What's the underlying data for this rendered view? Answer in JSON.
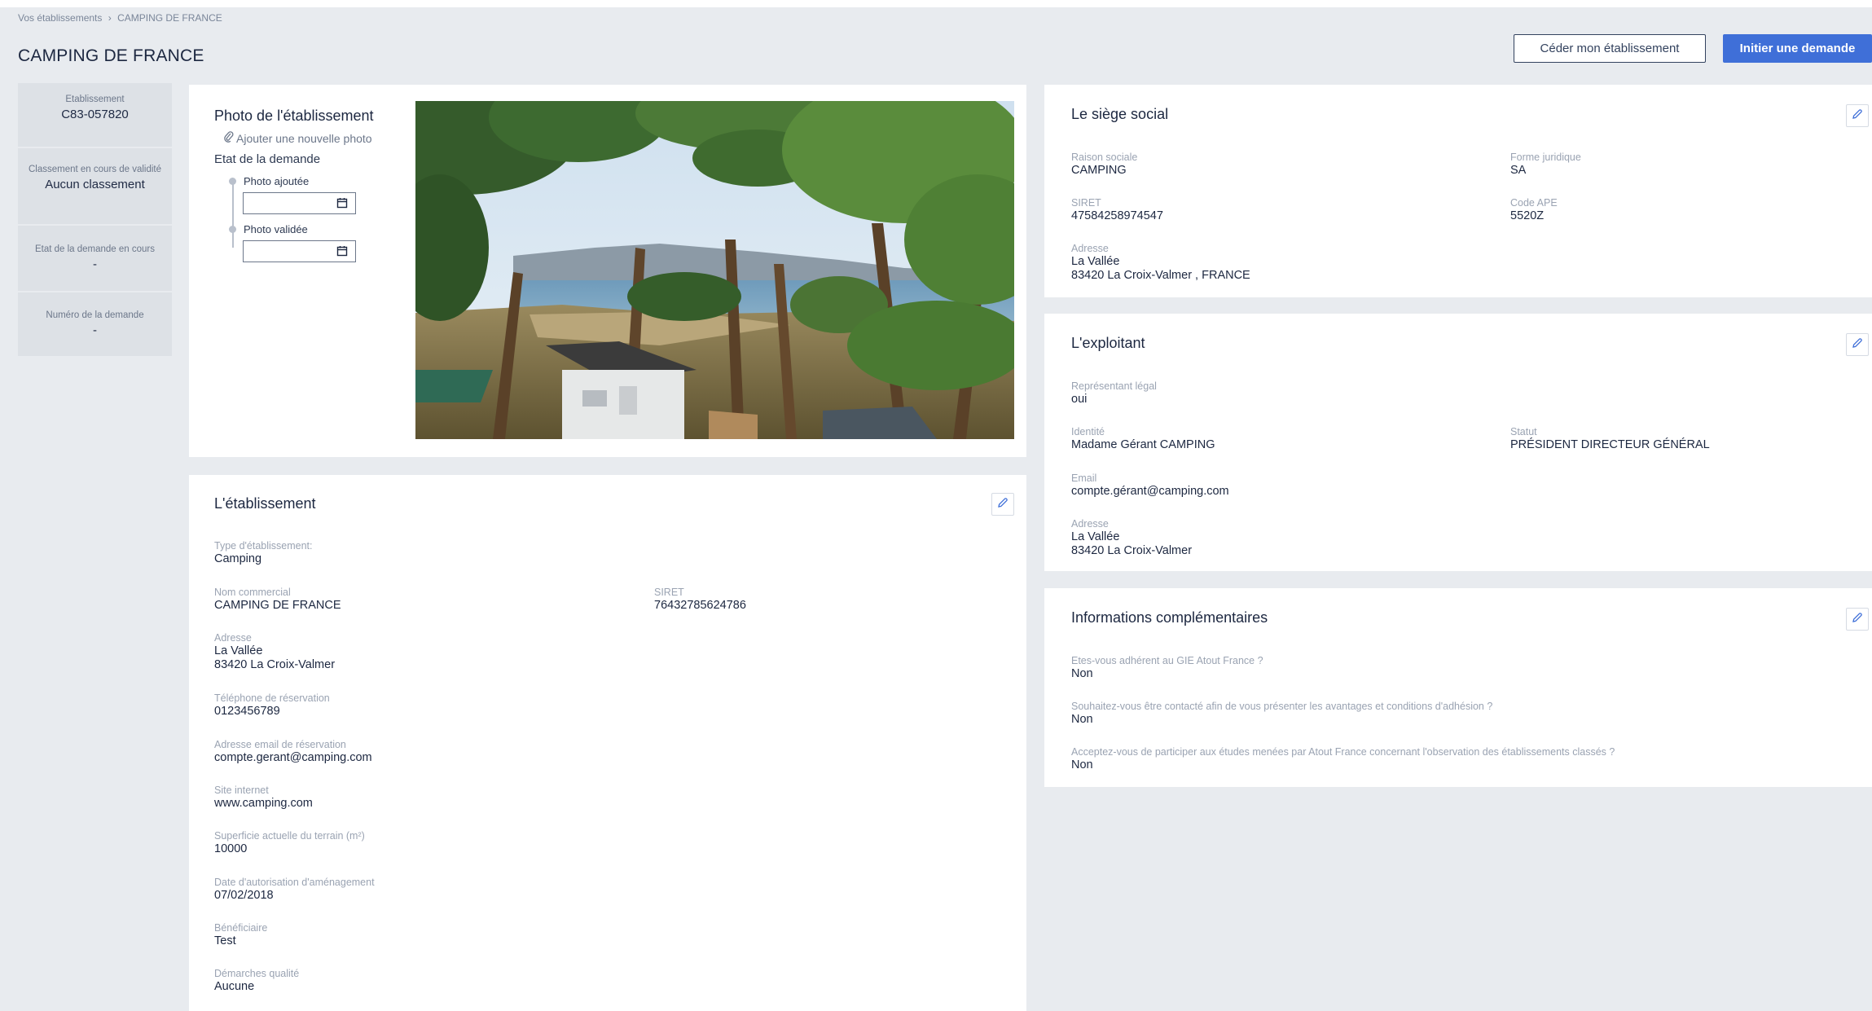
{
  "breadcrumb": {
    "parent": "Vos établissements",
    "separator": "›",
    "current": "CAMPING DE FRANCE"
  },
  "page_title": "CAMPING DE FRANCE",
  "actions": {
    "cede_label": "Céder mon établissement",
    "initiate_label": "Initier une demande"
  },
  "sidebar": {
    "items": [
      {
        "label": "Etablissement",
        "value": "C83-057820"
      },
      {
        "label": "Classement en cours de validité",
        "value": "Aucun classement"
      },
      {
        "label": "Etat de la demande en cours",
        "value": "-"
      },
      {
        "label": "Numéro de la demande",
        "value": "-"
      }
    ]
  },
  "photo_card": {
    "title": "Photo de l'établissement",
    "add_photo_label": "Ajouter une nouvelle photo",
    "state_label": "Etat de la demande",
    "steps": [
      {
        "label": "Photo ajoutée",
        "date": ""
      },
      {
        "label": "Photo validée",
        "date": ""
      }
    ]
  },
  "etablissement": {
    "title": "L'établissement",
    "type_label": "Type d'établissement:",
    "type_value": "Camping",
    "nom_label": "Nom commercial",
    "nom_value": "CAMPING DE FRANCE",
    "siret_label": "SIRET",
    "siret_value": "76432785624786",
    "adresse_label": "Adresse",
    "adresse_line1": "La Vallée",
    "adresse_line2": "83420 La Croix-Valmer",
    "tel_label": "Téléphone de réservation",
    "tel_value": "0123456789",
    "email_label": "Adresse email de réservation",
    "email_value": "compte.gerant@camping.com",
    "site_label": "Site internet",
    "site_value": "www.camping.com",
    "superficie_label": "Superficie actuelle du terrain (m²)",
    "superficie_value": "10000",
    "date_label": "Date d'autorisation d'aménagement",
    "date_value": "07/02/2018",
    "benef_label": "Bénéficiaire",
    "benef_value": "Test",
    "demarches_label": "Démarches qualité",
    "demarches_value": "Aucune"
  },
  "siege": {
    "title": "Le siège social",
    "raison_label": "Raison sociale",
    "raison_value": "CAMPING",
    "forme_label": "Forme juridique",
    "forme_value": "SA",
    "siret_label": "SIRET",
    "siret_value": "47584258974547",
    "ape_label": "Code APE",
    "ape_value": "5520Z",
    "adresse_label": "Adresse",
    "adresse_line1": "La Vallée",
    "adresse_line2": "83420 La Croix-Valmer , FRANCE"
  },
  "exploitant": {
    "title": "L'exploitant",
    "rep_label": "Représentant légal",
    "rep_value": "oui",
    "identite_label": "Identité",
    "identite_value": "Madame Gérant CAMPING",
    "statut_label": "Statut",
    "statut_value": "PRÉSIDENT DIRECTEUR GÉNÉRAL",
    "email_label": "Email",
    "email_value": "compte.gérant@camping.com",
    "adresse_label": "Adresse",
    "adresse_line1": "La Vallée",
    "adresse_line2": "83420 La Croix-Valmer"
  },
  "infos": {
    "title": "Informations complémentaires",
    "q1_label": "Etes-vous adhérent au GIE Atout France ?",
    "q1_value": "Non",
    "q2_label": "Souhaitez-vous être contacté afin de vous présenter les avantages et conditions d'adhésion ?",
    "q2_value": "Non",
    "q3_label": "Acceptez-vous de participer aux études menées par Atout France concernant l'observation des établissements classés ?",
    "q3_value": "Non"
  },
  "colors": {
    "primary": "#3f6fd8",
    "background": "#e8ebef",
    "card": "#ffffff",
    "sidebar": "#dde1e6"
  },
  "icons": {
    "edit": "pencil-icon",
    "attach": "paperclip-icon",
    "date": "calendar-icon"
  }
}
